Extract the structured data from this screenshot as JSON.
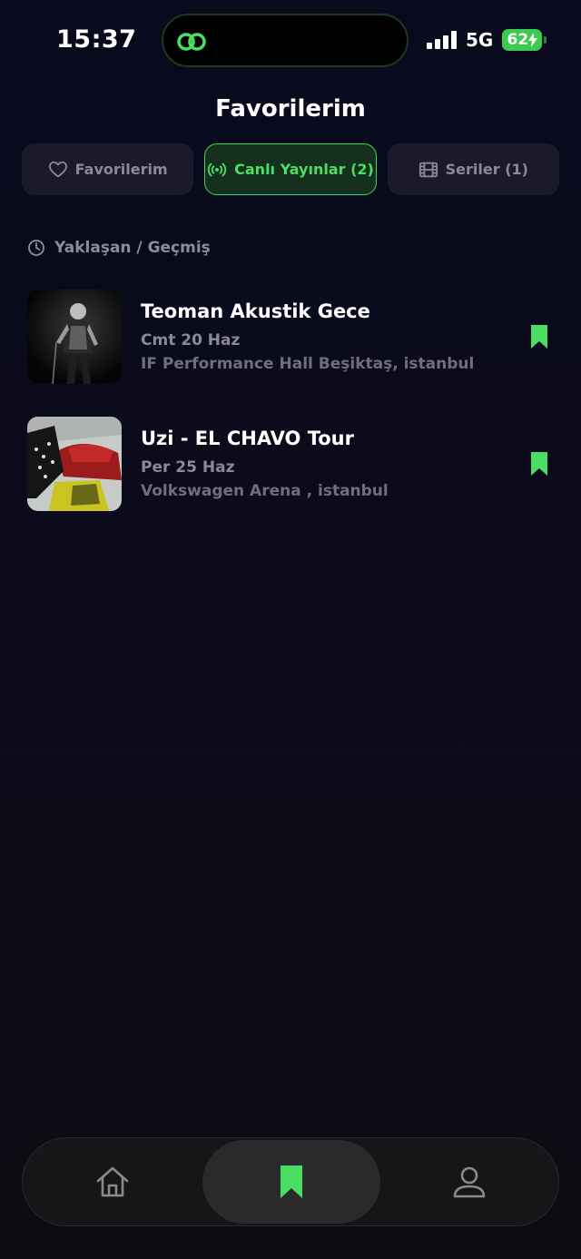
{
  "status_bar": {
    "time": "15:37",
    "network": "5G",
    "battery": "62",
    "island_icon": "link-rings-icon"
  },
  "header": {
    "title": "Favorilerim"
  },
  "tabs": [
    {
      "label": "Favorilerim",
      "icon": "heart-icon",
      "active": false
    },
    {
      "label": "Canlı Yayınlar (2)",
      "icon": "broadcast-icon",
      "active": true
    },
    {
      "label": "Seriler (1)",
      "icon": "film-icon",
      "active": false
    }
  ],
  "section": {
    "label": "Yaklaşan / Geçmiş",
    "icon": "clock-icon"
  },
  "events": [
    {
      "title": "Teoman Akustik Gece",
      "date": "Cmt 20 Haz",
      "venue": "IF Performance Hall Beşiktaş, istanbul",
      "bookmarked": true
    },
    {
      "title": "Uzi - EL CHAVO Tour",
      "date": "Per 25 Haz",
      "venue": "Volkswagen Arena , istanbul",
      "bookmarked": true
    }
  ],
  "bottom_nav": {
    "items": [
      {
        "icon": "home-icon",
        "active": false
      },
      {
        "icon": "bookmark-icon",
        "active": true
      },
      {
        "icon": "profile-icon",
        "active": false
      }
    ]
  },
  "colors": {
    "accent": "#4ade64",
    "background": "#0a0a1e",
    "muted_text": "#8a8a96"
  }
}
